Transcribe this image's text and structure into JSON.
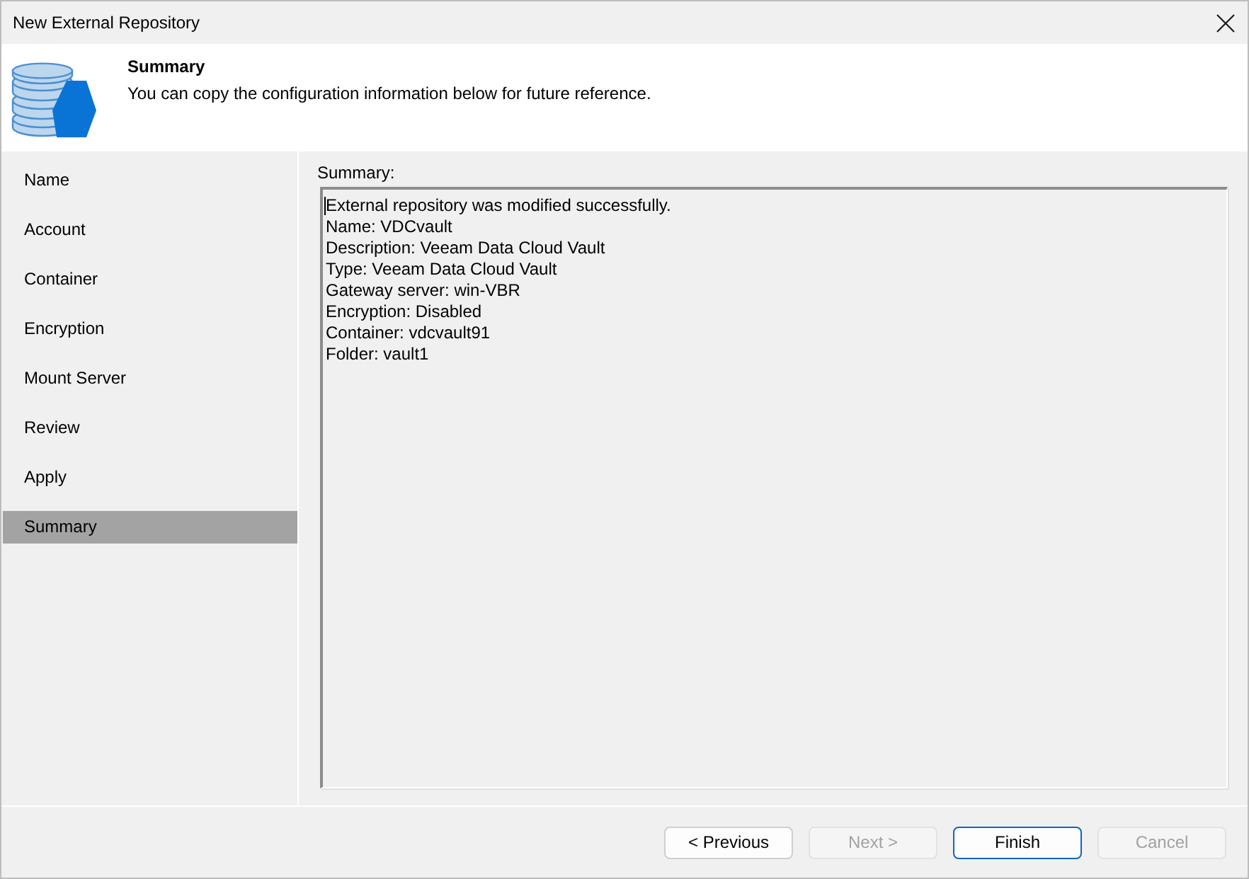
{
  "window": {
    "title": "New External Repository"
  },
  "header": {
    "title": "Summary",
    "subtitle": "You can copy the configuration information below for future reference."
  },
  "steps": [
    {
      "label": "Name",
      "selected": false
    },
    {
      "label": "Account",
      "selected": false
    },
    {
      "label": "Container",
      "selected": false
    },
    {
      "label": "Encryption",
      "selected": false
    },
    {
      "label": "Mount Server",
      "selected": false
    },
    {
      "label": "Review",
      "selected": false
    },
    {
      "label": "Apply",
      "selected": false
    },
    {
      "label": "Summary",
      "selected": true
    }
  ],
  "summary": {
    "label": "Summary:",
    "lines": [
      "External repository was modified successfully.",
      "Name: VDCvault",
      "Description: Veeam Data Cloud Vault",
      "Type: Veeam Data Cloud Vault",
      "Gateway server: win-VBR",
      "Encryption: Disabled",
      "Container: vdcvault91",
      "Folder: vault1"
    ]
  },
  "buttons": [
    {
      "label": "< Previous",
      "disabled": false,
      "focused": false
    },
    {
      "label": "Next >",
      "disabled": true,
      "focused": false
    },
    {
      "label": "Finish",
      "disabled": false,
      "focused": true
    },
    {
      "label": "Cancel",
      "disabled": true,
      "focused": false
    }
  ]
}
